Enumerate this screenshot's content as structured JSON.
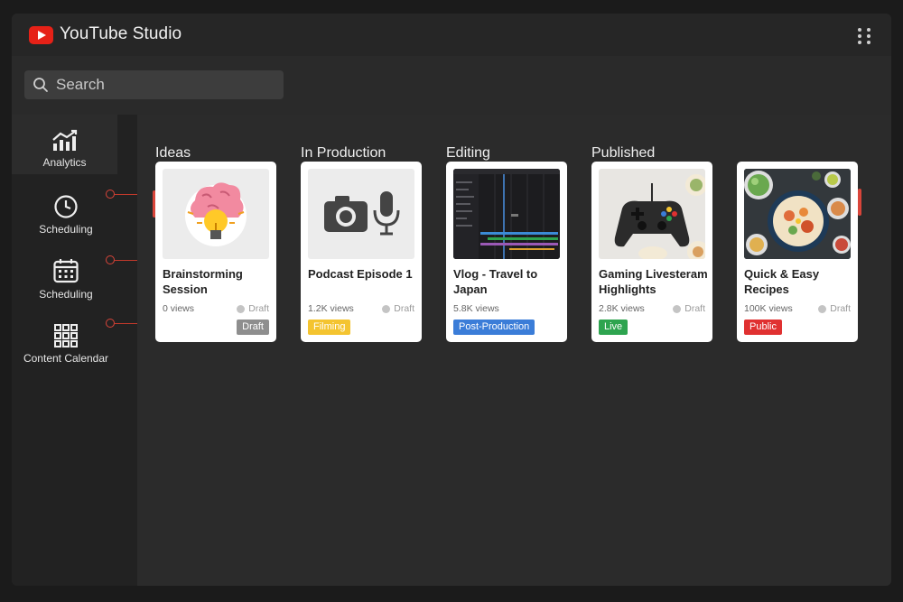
{
  "app": {
    "title": "YouTube Studio"
  },
  "search": {
    "placeholder": "Search"
  },
  "sidebar": {
    "items": [
      {
        "label": "Analytics",
        "icon": "analytics-chart-icon"
      },
      {
        "label": "Scheduling",
        "icon": "clock-icon"
      },
      {
        "label": "Scheduling",
        "icon": "calendar-icon"
      },
      {
        "label": "Content Calendar",
        "icon": "grid-icon"
      }
    ]
  },
  "board": {
    "columns": [
      {
        "title": "Ideas"
      },
      {
        "title": "In Production"
      },
      {
        "title": "Editing"
      },
      {
        "title": "Published"
      }
    ],
    "cards": [
      {
        "title": "Brainstorming Session",
        "views": "0 views",
        "status": "Draft",
        "badge": "Draft",
        "badge_color": "#8e8e8e",
        "thumb": "brain-lightbulb-icon"
      },
      {
        "title": "Podcast Episode 1",
        "views": "1.2K views",
        "status": "Draft",
        "badge": "Filming",
        "badge_color": "#f4c430",
        "thumb": "camera-microphone-icon"
      },
      {
        "title": "Vlog - Travel to Japan",
        "views": "5.8K views",
        "status": "",
        "badge": "Post-Production",
        "badge_color": "#3b7dd8",
        "thumb": "video-editor-timeline"
      },
      {
        "title": "Gaming Livesteram Highlights",
        "views": "2.8K views",
        "status": "Draft",
        "badge": "Live",
        "badge_color": "#2ea44f",
        "thumb": "gamepad-icon"
      },
      {
        "title": "Quick & Easy Recipes",
        "views": "100K views",
        "status": "Draft",
        "badge": "Public",
        "badge_color": "#e03131",
        "thumb": "food-plates-photo"
      }
    ]
  },
  "colors": {
    "accent": "#e62117",
    "connector": "#d9453a"
  }
}
